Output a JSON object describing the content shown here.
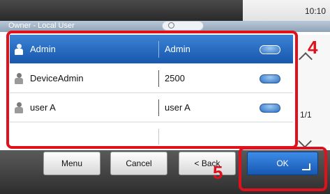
{
  "status_bar": {
    "time": "10:10"
  },
  "title": {
    "text": "Owner - Local User"
  },
  "list": {
    "rows": [
      {
        "name": "Admin",
        "value": "Admin",
        "selected": true
      },
      {
        "name": "DeviceAdmin",
        "value": "2500",
        "selected": false
      },
      {
        "name": "user A",
        "value": "user A",
        "selected": false
      },
      {
        "name": "",
        "value": "",
        "selected": false
      }
    ]
  },
  "pagination": {
    "page": "1/1"
  },
  "buttons": {
    "menu": "Menu",
    "cancel": "Cancel",
    "back": "< Back",
    "ok": "OK"
  },
  "callouts": {
    "list": "4",
    "ok": "5"
  },
  "colors": {
    "selected_row": "#1f68c0",
    "callout_red": "#e0101c",
    "ok_button": "#2a74d0"
  }
}
